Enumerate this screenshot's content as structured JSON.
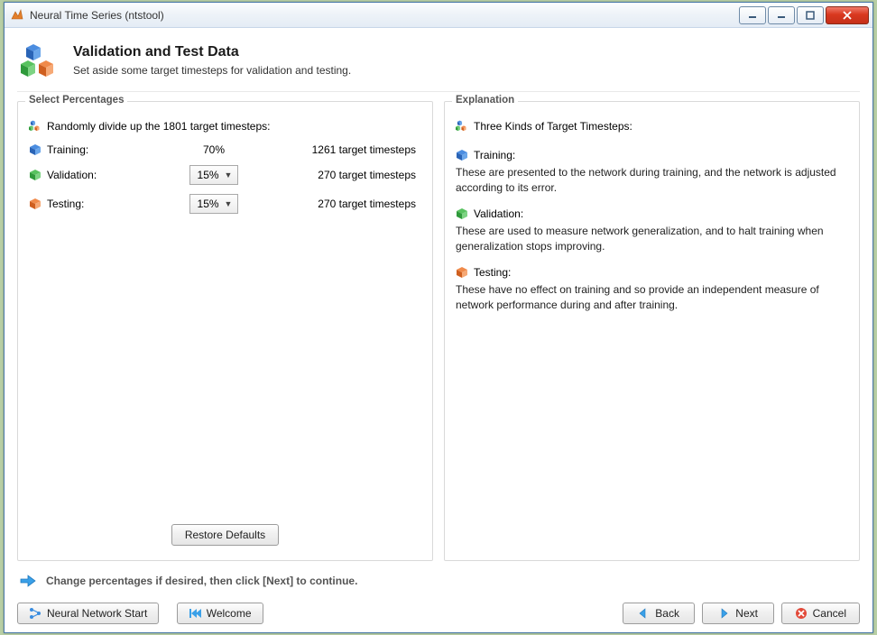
{
  "window": {
    "title": "Neural Time Series (ntstool)"
  },
  "header": {
    "title": "Validation and Test Data",
    "subtitle": "Set aside some target timesteps for validation and testing."
  },
  "percentages": {
    "group_title": "Select Percentages",
    "intro": "Randomly divide up the 1801 target timesteps:",
    "rows": {
      "training": {
        "label": "Training:",
        "percent": "70%",
        "count": "1261 target timesteps"
      },
      "validation": {
        "label": "Validation:",
        "percent": "15%",
        "count": "270 target timesteps"
      },
      "testing": {
        "label": "Testing:",
        "percent": "15%",
        "count": "270 target timesteps"
      }
    },
    "restore_label": "Restore Defaults"
  },
  "explanation": {
    "group_title": "Explanation",
    "heading": "Three Kinds of Target Timesteps:",
    "training": {
      "label": "Training:",
      "text": "These are presented to the network during training, and the network is adjusted according to its error."
    },
    "validation": {
      "label": "Validation:",
      "text": "These are used to measure network generalization, and to halt training when generalization stops improving."
    },
    "testing": {
      "label": "Testing:",
      "text": "These have no effect on training and so provide an independent measure of network performance during and after training."
    }
  },
  "hint": "Change percentages if desired, then click [Next] to continue.",
  "buttons": {
    "nn_start": "Neural Network Start",
    "welcome": "Welcome",
    "back": "Back",
    "next": "Next",
    "cancel": "Cancel"
  },
  "colors": {
    "training": "#2f6ed1",
    "validation": "#2fa845",
    "testing": "#e06a2b"
  }
}
